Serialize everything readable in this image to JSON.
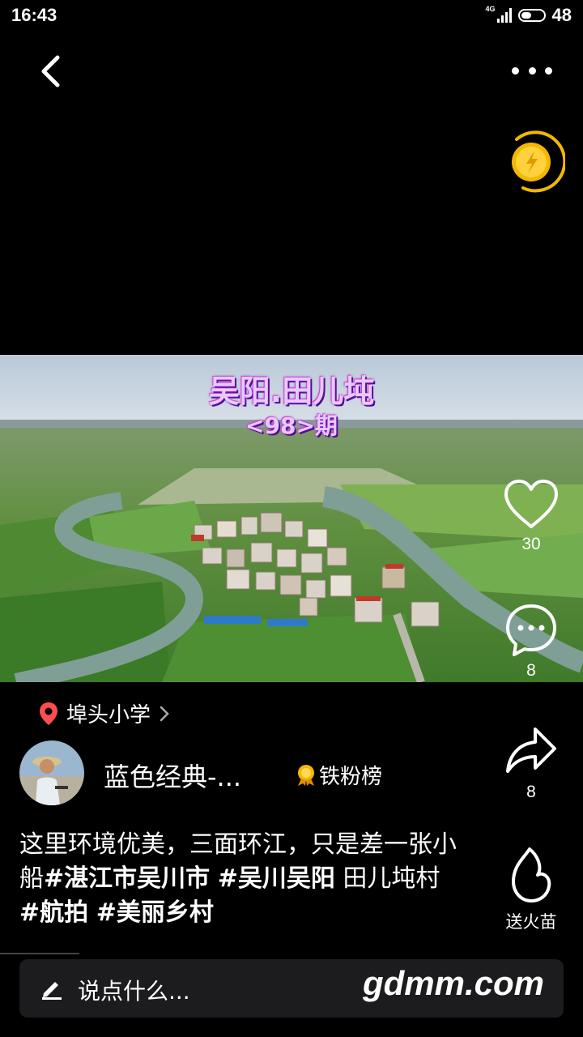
{
  "status_bar": {
    "time": "16:43",
    "network": "4G",
    "battery": "48",
    "battery_level": 0.48
  },
  "video": {
    "title_line1": "吴阳.田儿坉",
    "title_line2": "<98>期"
  },
  "actions": {
    "likes": "30",
    "comments": "8",
    "shares": "8",
    "fire_label": "送火苗"
  },
  "location": {
    "name": "埠头小学"
  },
  "author": {
    "name": "蓝色经典-...",
    "badge_label": "铁粉榜"
  },
  "description": {
    "plain1": "这里环境优美，三面环江，只是差一张小船",
    "tag1": "#湛江市吴川市",
    "space1": " ",
    "tag2": "#吴川吴阳",
    "plain2": " 田儿坉村",
    "tag3": "#航拍",
    "space2": " ",
    "tag4": "#美丽乡村"
  },
  "comment_bar": {
    "placeholder": "说点什么..."
  },
  "watermark": "gdmm.com",
  "colors": {
    "accent_gold": "#f5b800",
    "location_pin": "#ff4d4f",
    "title_glow": "#8a2be2"
  }
}
